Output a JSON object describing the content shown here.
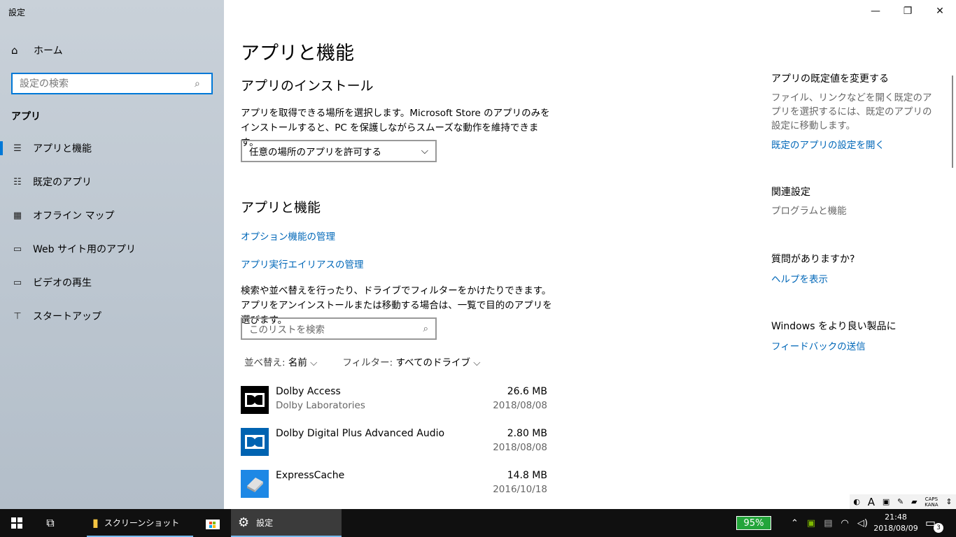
{
  "window": {
    "title": "設定",
    "controls": {
      "minimize": "—",
      "maximize": "❐",
      "close": "✕"
    }
  },
  "sidebar": {
    "home_label": "ホーム",
    "search_placeholder": "設定の検索",
    "section": "アプリ",
    "items": [
      {
        "label": "アプリと機能",
        "icon": "apps-features-icon",
        "glyph": "☰",
        "selected": true
      },
      {
        "label": "既定のアプリ",
        "icon": "default-apps-icon",
        "glyph": "☷",
        "selected": false
      },
      {
        "label": "オフライン マップ",
        "icon": "offline-maps-icon",
        "glyph": "▦",
        "selected": false
      },
      {
        "label": "Web サイト用のアプリ",
        "icon": "website-apps-icon",
        "glyph": "▭",
        "selected": false
      },
      {
        "label": "ビデオの再生",
        "icon": "video-playback-icon",
        "glyph": "▭",
        "selected": false
      },
      {
        "label": "スタートアップ",
        "icon": "startup-icon",
        "glyph": "⊤",
        "selected": false
      }
    ]
  },
  "main": {
    "page_title": "アプリと機能",
    "install_heading": "アプリのインストール",
    "install_desc": "アプリを取得できる場所を選択します。Microsoft Store のアプリのみをインストールすると、PC を保護しながらスムーズな動作を維持できます。",
    "install_dropdown": "任意の場所のアプリを許可する",
    "features_heading": "アプリと機能",
    "optional_features_link": "オプション機能の管理",
    "alias_link": "アプリ実行エイリアスの管理",
    "list_desc": "検索や並べ替えを行ったり、ドライブでフィルターをかけたりできます。アプリをアンインストールまたは移動する場合は、一覧で目的のアプリを選びます。",
    "list_search_placeholder": "このリストを検索",
    "sort_label": "並べ替え:",
    "sort_value": "名前",
    "filter_label": "フィルター:",
    "filter_value": "すべてのドライブ",
    "apps": [
      {
        "name": "Dolby Access",
        "publisher": "Dolby Laboratories",
        "size": "26.6 MB",
        "date": "2018/08/08",
        "icon": "dolby-access-icon"
      },
      {
        "name": "Dolby Digital Plus Advanced Audio",
        "publisher": "",
        "size": "2.80 MB",
        "date": "2018/08/08",
        "icon": "dolby-digital-icon"
      },
      {
        "name": "ExpressCache",
        "publisher": "",
        "size": "14.8 MB",
        "date": "2016/10/18",
        "icon": "expresscache-icon"
      }
    ]
  },
  "right_pane": {
    "defaults_heading": "アプリの既定値を変更する",
    "defaults_text": "ファイル、リンクなどを開く既定のアプリを選択するには、既定のアプリの設定に移動します。",
    "defaults_link": "既定のアプリの設定を開く",
    "related_heading": "関連設定",
    "related_item": "プログラムと機能",
    "question_heading": "質問がありますか?",
    "help_link": "ヘルプを表示",
    "feedback_heading": "Windows をより良い製品に",
    "feedback_link": "フィードバックの送信"
  },
  "tray_strip": {
    "caps_top": "CAPS",
    "caps_bottom": "KANA",
    "font_glyph": "A"
  },
  "taskbar": {
    "explorer_label": "スクリーンショット",
    "settings_label": "設定",
    "battery": "95%",
    "time": "21:48",
    "date": "2018/08/09",
    "notification_count": "3",
    "colors": {
      "accent": "#0078d7",
      "link": "#0067b8",
      "battery": "#23a53a"
    }
  }
}
